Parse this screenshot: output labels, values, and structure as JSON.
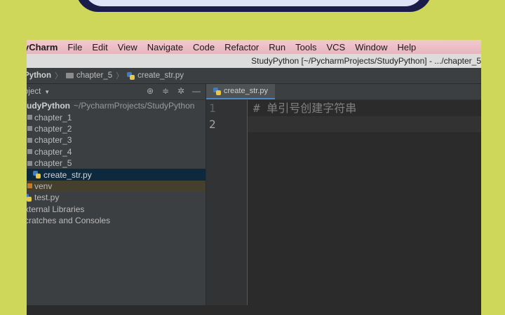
{
  "menubar": {
    "app": "yCharm",
    "items": [
      "File",
      "Edit",
      "View",
      "Navigate",
      "Code",
      "Refactor",
      "Run",
      "Tools",
      "VCS",
      "Window",
      "Help"
    ]
  },
  "window": {
    "title": "StudyPython [~/PycharmProjects/StudyPython] - .../chapter_5"
  },
  "breadcrumb": {
    "items": [
      "Python",
      "chapter_5",
      "create_str.py"
    ]
  },
  "project": {
    "header_label": "oject",
    "tools": [
      "target-icon",
      "collapse-icon",
      "gear-icon",
      "minimize-icon"
    ],
    "root_name": "tudyPython",
    "root_path": "~/PycharmProjects/StudyPython",
    "items": [
      {
        "label": "chapter_1",
        "type": "folder"
      },
      {
        "label": "chapter_2",
        "type": "folder"
      },
      {
        "label": "chapter_3",
        "type": "folder"
      },
      {
        "label": "chapter_4",
        "type": "folder"
      },
      {
        "label": "chapter_5",
        "type": "folder"
      },
      {
        "label": "create_str.py",
        "type": "python-file",
        "selected": true
      },
      {
        "label": "venv",
        "type": "excluded-folder"
      },
      {
        "label": "test.py",
        "type": "python-file"
      },
      {
        "label": "xternal Libraries",
        "type": "library"
      },
      {
        "label": "cratches and Consoles",
        "type": "scratches"
      }
    ]
  },
  "editor": {
    "tab_label": "create_str.py",
    "line_numbers": [
      "1",
      "2"
    ],
    "lines": [
      "#  单引号创建字符串",
      ""
    ]
  },
  "colors": {
    "background": "#cfd75a",
    "accent": "#4a88c7",
    "selection": "#0d293e"
  }
}
